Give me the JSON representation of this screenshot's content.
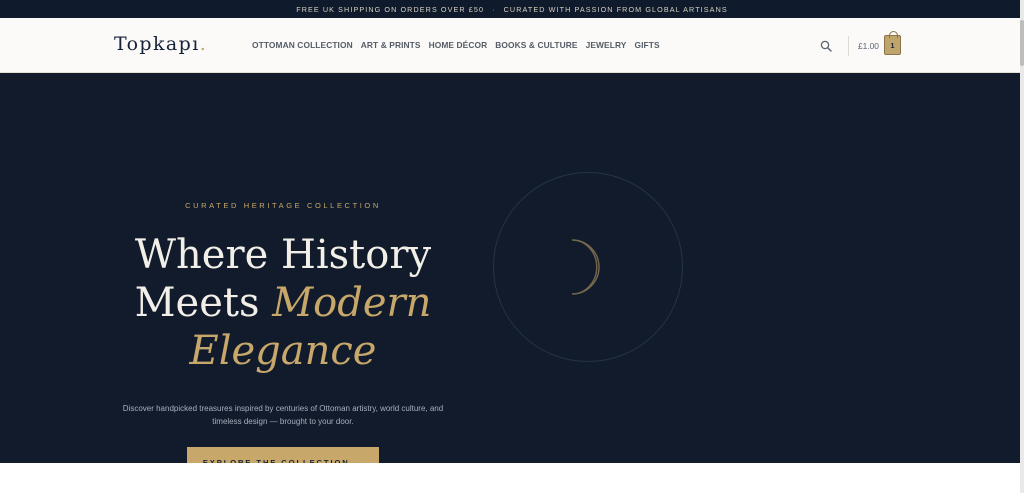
{
  "topbar": {
    "left_text": "FREE UK SHIPPING ON ORDERS OVER £50",
    "separator": "·",
    "right_text": "CURATED WITH PASSION FROM GLOBAL ARTISANS"
  },
  "header": {
    "logo": "Topkapı",
    "logo_dot": ".",
    "nav": [
      {
        "label": "OTTOMAN COLLECTION"
      },
      {
        "label": "ART & PRINTS"
      },
      {
        "label": "HOME DÉCOR"
      },
      {
        "label": "BOOKS & CULTURE"
      },
      {
        "label": "JEWELRY"
      },
      {
        "label": "GIFTS"
      }
    ],
    "search_icon": "search-icon",
    "cart_total": "£1.00",
    "cart_count": "1"
  },
  "hero": {
    "eyebrow": "CURATED HERITAGE COLLECTION",
    "headline_line1": "Where History",
    "headline_line2_plain": "Meets ",
    "headline_line2_accent": "Modern",
    "headline_line3_accent": "Elegance",
    "subtext": "Discover handpicked treasures inspired by centuries of Ottoman artistry, world culture, and timeless design — brought to your door.",
    "cta_label": "EXPLORE THE COLLECTION →",
    "decor_icon": "crescent-moon-icon"
  },
  "colors": {
    "navy": "#111b2b",
    "gold": "#c7a86a",
    "header_bg": "#fbfaf8"
  }
}
